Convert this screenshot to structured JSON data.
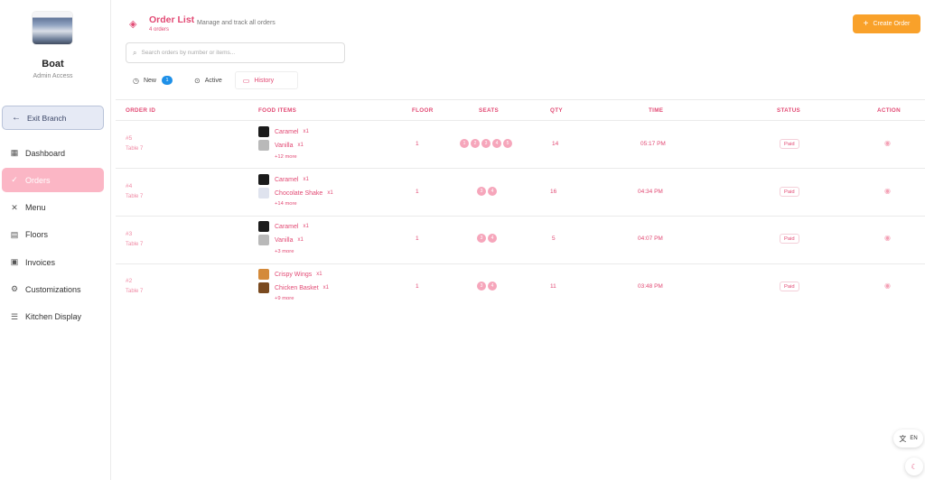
{
  "sidebar": {
    "brand": "Boat",
    "role": "Admin Access",
    "exit_label": "Exit Branch",
    "items": [
      {
        "label": "Dashboard",
        "icon": "grid-icon"
      },
      {
        "label": "Orders",
        "icon": "check-circle-icon",
        "active": true
      },
      {
        "label": "Menu",
        "icon": "utensils-icon"
      },
      {
        "label": "Floors",
        "icon": "building-icon"
      },
      {
        "label": "Invoices",
        "icon": "receipt-icon"
      },
      {
        "label": "Customizations",
        "icon": "gear-icon"
      },
      {
        "label": "Kitchen Display",
        "icon": "list-check-icon"
      }
    ]
  },
  "header": {
    "title": "Order List",
    "subtitle": "Manage and track all orders",
    "count": "4 orders",
    "create_label": "Create Order"
  },
  "search": {
    "placeholder": "Search orders by number or items..."
  },
  "tabs": {
    "new_label": "New",
    "new_count": "1",
    "active_label": "Active",
    "history_label": "History"
  },
  "table": {
    "columns": {
      "order_id": "ORDER ID",
      "food_items": "FOOD ITEMS",
      "floor": "FLOOR",
      "seats": "SEATS",
      "qty": "QTY",
      "time": "TIME",
      "status": "STATUS",
      "action": "ACTION"
    },
    "rows": [
      {
        "order_id": "#5",
        "table": "Table 7",
        "items": [
          {
            "name": "Caramel",
            "qty": "x1"
          },
          {
            "name": "Vanilla",
            "qty": "x1"
          }
        ],
        "more": "+12 more",
        "floor": "1",
        "seats": [
          "1",
          "2",
          "3",
          "4",
          "5"
        ],
        "qty": "14",
        "time": "05:17 PM",
        "status": "Paid"
      },
      {
        "order_id": "#4",
        "table": "Table 7",
        "items": [
          {
            "name": "Caramel",
            "qty": "x1"
          },
          {
            "name": "Chocolate Shake",
            "qty": "x1"
          }
        ],
        "more": "+14 more",
        "floor": "1",
        "seats": [
          "3",
          "4"
        ],
        "qty": "16",
        "time": "04:34 PM",
        "status": "Paid"
      },
      {
        "order_id": "#3",
        "table": "Table 7",
        "items": [
          {
            "name": "Caramel",
            "qty": "x1"
          },
          {
            "name": "Vanilla",
            "qty": "x1"
          }
        ],
        "more": "+3 more",
        "floor": "1",
        "seats": [
          "3",
          "4"
        ],
        "qty": "5",
        "time": "04:07 PM",
        "status": "Paid"
      },
      {
        "order_id": "#2",
        "table": "Table 7",
        "items": [
          {
            "name": "Crispy Wings",
            "qty": "x1"
          },
          {
            "name": "Chicken Basket",
            "qty": "x1"
          }
        ],
        "more": "+9 more",
        "floor": "1",
        "seats": [
          "3",
          "4"
        ],
        "qty": "11",
        "time": "03:48 PM",
        "status": "Paid"
      }
    ]
  },
  "floating": {
    "language": "EN"
  },
  "colors": {
    "accent": "#e24a74",
    "primary_button": "#f9a12a",
    "active_nav": "#fbb6c5",
    "badge": "#1e90e8"
  }
}
